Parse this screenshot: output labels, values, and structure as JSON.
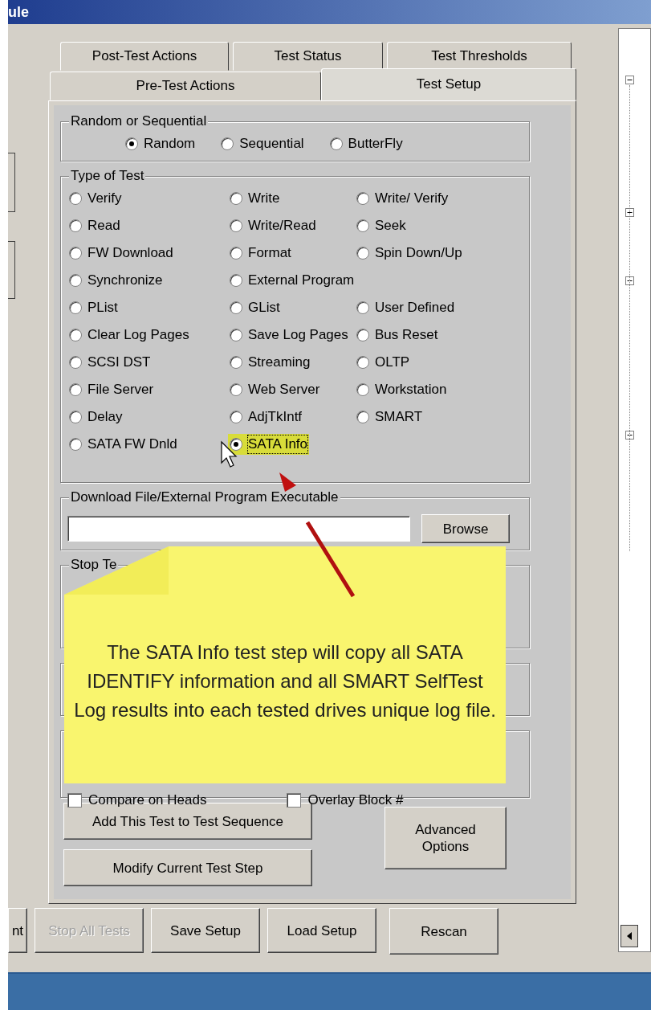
{
  "window": {
    "title": "ule"
  },
  "tabs": {
    "back_row": [
      {
        "label": "Post-Test Actions",
        "selected": false
      },
      {
        "label": "Test Status",
        "selected": false
      },
      {
        "label": "Test Thresholds",
        "selected": false
      }
    ],
    "front_row": [
      {
        "label": "Pre-Test Actions",
        "selected": false
      },
      {
        "label": "Test Setup",
        "selected": true
      }
    ]
  },
  "random_or_sequential": {
    "title": "Random or Sequential",
    "options": [
      {
        "label": "Random",
        "selected": true
      },
      {
        "label": "Sequential",
        "selected": false
      },
      {
        "label": "ButterFly",
        "selected": false
      }
    ]
  },
  "type_of_test": {
    "title": "Type of Test",
    "rows": [
      [
        {
          "label": "Verify",
          "selected": false,
          "highlighted": false
        },
        {
          "label": "Write",
          "selected": false,
          "highlighted": false
        },
        {
          "label": "Write/ Verify",
          "selected": false,
          "highlighted": false
        }
      ],
      [
        {
          "label": "Read",
          "selected": false,
          "highlighted": false
        },
        {
          "label": "Write/Read",
          "selected": false,
          "highlighted": false
        },
        {
          "label": "Seek",
          "selected": false,
          "highlighted": false
        }
      ],
      [
        {
          "label": "FW Download",
          "selected": false,
          "highlighted": false
        },
        {
          "label": "Format",
          "selected": false,
          "highlighted": false
        },
        {
          "label": "Spin Down/Up",
          "selected": false,
          "highlighted": false
        }
      ],
      [
        {
          "label": "Synchronize",
          "selected": false,
          "highlighted": false
        },
        {
          "label": "External Program",
          "selected": false,
          "highlighted": false
        }
      ],
      [
        {
          "label": "PList",
          "selected": false,
          "highlighted": false
        },
        {
          "label": "GList",
          "selected": false,
          "highlighted": false
        },
        {
          "label": "User Defined",
          "selected": false,
          "highlighted": false
        }
      ],
      [
        {
          "label": "Clear Log Pages",
          "selected": false,
          "highlighted": false
        },
        {
          "label": "Save Log Pages",
          "selected": false,
          "highlighted": false
        },
        {
          "label": "Bus Reset",
          "selected": false,
          "highlighted": false
        }
      ],
      [
        {
          "label": "SCSI DST",
          "selected": false,
          "highlighted": false
        },
        {
          "label": "Streaming",
          "selected": false,
          "highlighted": false
        },
        {
          "label": "OLTP",
          "selected": false,
          "highlighted": false
        }
      ],
      [
        {
          "label": "File Server",
          "selected": false,
          "highlighted": false
        },
        {
          "label": "Web Server",
          "selected": false,
          "highlighted": false
        },
        {
          "label": "Workstation",
          "selected": false,
          "highlighted": false
        }
      ],
      [
        {
          "label": "Delay",
          "selected": false,
          "highlighted": false
        },
        {
          "label": "AdjTkIntf",
          "selected": false,
          "highlighted": false
        },
        {
          "label": "SMART",
          "selected": false,
          "highlighted": false
        }
      ],
      [
        {
          "label": "SATA FW Dnld",
          "selected": false,
          "highlighted": false
        },
        {
          "label": "SATA Info",
          "selected": true,
          "highlighted": true
        }
      ]
    ]
  },
  "download": {
    "title": "Download File/External Program Executable",
    "button": "Browse"
  },
  "stop_test": {
    "title": "Stop Te"
  },
  "options": {
    "checkboxes": [
      {
        "label": "Compare on Heads",
        "checked": false
      },
      {
        "label": "Overlay Block #",
        "checked": false
      }
    ]
  },
  "actions": {
    "add": "Add This Test to Test Sequence",
    "modify": "Modify Current Test Step",
    "advanced": "Advanced Options"
  },
  "bottom_buttons": [
    {
      "label": "nt",
      "disabled": false
    },
    {
      "label": "Stop All Tests",
      "disabled": true
    },
    {
      "label": "Save Setup",
      "disabled": false
    },
    {
      "label": "Load Setup",
      "disabled": false
    },
    {
      "label": "Rescan",
      "disabled": false
    }
  ],
  "callout": {
    "text": "The SATA Info test step will copy all SATA IDENTIFY information and all SMART SelfTest Log results into each tested drives unique log file."
  }
}
